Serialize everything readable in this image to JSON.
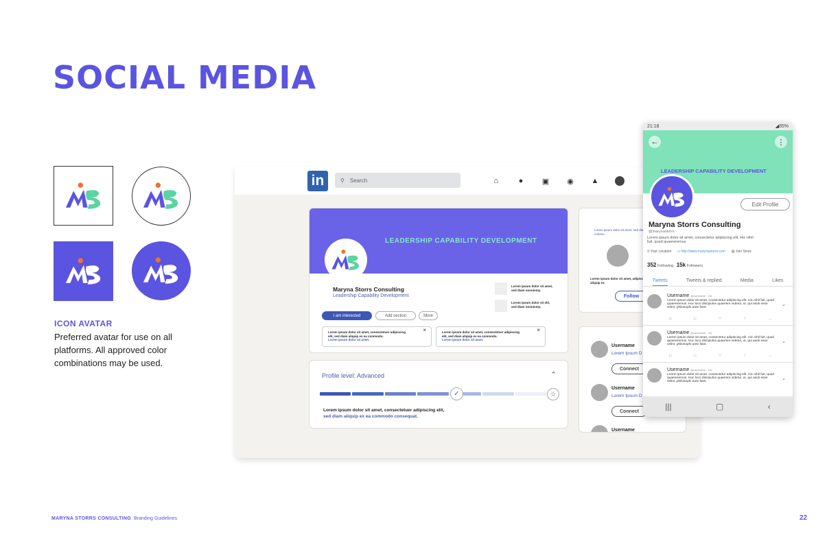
{
  "page": {
    "title": "SOCIAL MEDIA",
    "page_number": "22"
  },
  "footer": {
    "company": "MARYNA STORRS CONSULTING",
    "doc": "Branding Guidelines"
  },
  "avatar_section": {
    "heading": "ICON AVATAR",
    "body": "Preferred avatar for use on all platforms. All approved color combinations may be used."
  },
  "colors": {
    "brand": "#5b54e0",
    "mint": "#7fe2b8",
    "linkedin": "#2f63b0"
  },
  "linkedin": {
    "logo": "in",
    "search_placeholder": "Search",
    "banner": "LEADERSHIP CAPABILITY DEVELOPMENT",
    "name": "Maryna Storrs Consulting",
    "headline": "Leadership Capability Development",
    "side_items": [
      "Lorem ipsum dolor sit amet, sed diam nonummy.",
      "Lorem ipsum dolor sit elit, sed diam nonummy."
    ],
    "buttons": {
      "interested": "I am interested",
      "add": "Add section",
      "more": "More"
    },
    "mini_cards": [
      {
        "text": "Lorem ipsum dolor sit amet, consectetuer adipiscing elit, sed diam aliquip ex ea commodo.",
        "link": "Lorem ipsum dolor sit amet."
      },
      {
        "text": "Lorem ipsum dolor sit amet, consectetuer adipiscing elit, sed diam aliquip ex ea commodo.",
        "link": "Lorem ipsum dolor sit amet."
      }
    ],
    "profile_level": "Profile level: Advanced",
    "profile_level_progress": 0.55,
    "level_desc_1": "Lorem ipsum dolor sit amet, consectetuer adipiscing elit,",
    "level_desc_2": "sed diam aliquip ex ea commodo consequat.",
    "follow_card_top": "Lorem ipsum dolor sit amet, sed diam aliquip ex ea commo",
    "follow_card_mid": "Lorem ipsum dolor sit amet, adipiscing elit, sed diam aliquip ex",
    "follow": "Follow",
    "people": [
      {
        "name": "Username",
        "sub": "Lorem Ipsum D",
        "button": "Connect"
      },
      {
        "name": "Username",
        "sub": "Lorem Ipsum D",
        "button": "Connect"
      },
      {
        "name": "Username"
      }
    ]
  },
  "twitter": {
    "time": "21:18",
    "battery": "◢85%",
    "banner": "LEADERSHIP CAPABILITY DEVELOPMENT",
    "edit": "Edit Profile",
    "name": "Maryna Storrs Consulting",
    "handle": "@marynastorrs",
    "bio": "Lorem ipsum dolor sit amet, consectetur adipiscing elit. Hic nihil fuit, quod quaereremus",
    "location": "Your Location",
    "url": "http://www.marynastorrs.com",
    "joined": "Join Since",
    "following_count": "352",
    "following_label": "Following",
    "followers_count": "15k",
    "followers_label": "Followers",
    "tabs": [
      "Tweets",
      "Tweets & replied",
      "Media",
      "Likes"
    ],
    "tweets": [
      {
        "user": "Username",
        "meta": "@username · 2m",
        "text": "Lorem ipsum dolor sit amet, consectetur adipiscing elit. Hic nihil fuit, quod quaereremus. Hoc loco discipulos quaerere videtur, ut, qui asoti esse velint, philosophi ante fiant."
      },
      {
        "user": "Username",
        "meta": "@username · 2m",
        "text": "Lorem ipsum dolor sit amet, consectetur adipiscing elit. Hic nihil fuit, quod quaereremus. Hoc loco discipulos quaerere videtur, ut, qui asoti esse velint, philosophi ante fiant."
      },
      {
        "user": "Username",
        "meta": "@username · 2m",
        "text": "Lorem ipsum dolor sit amet, consectetur adipiscing elit. Hic nihil fuit, quod quaereremus. Hoc loco discipulos quaerere videtur, ut, qui asoti esse velint, philosophi ante fiant."
      }
    ]
  }
}
